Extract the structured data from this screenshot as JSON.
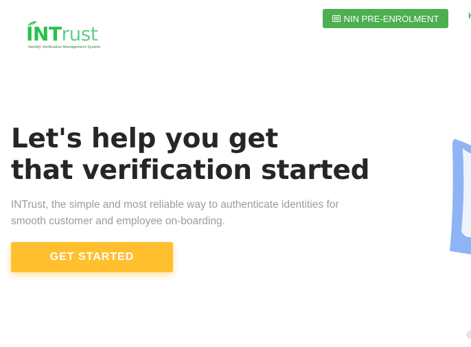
{
  "brand": {
    "logo_int": "INT",
    "logo_rust": "rust",
    "tagline": "Identity Verification Management System"
  },
  "header": {
    "nin_button_label": "NIN PRE-ENROLMENT",
    "nav_peek": "H"
  },
  "hero": {
    "title_line1": "Let's help you get",
    "title_line2": "that verification started",
    "subtitle": "INTrust, the simple and most reliable way to authenticate identities for smooth customer and employee on-boarding.",
    "cta_label": "GET STARTED"
  },
  "colors": {
    "brand_green": "#27c24c",
    "button_green": "#4caf50",
    "cta_yellow": "#ffbf2f",
    "title_text": "#262626",
    "subtitle_text": "#9a9aa4",
    "illustration_blue": "#8fb4f5"
  },
  "icons": {
    "nin_button_icon": "id-card-icon",
    "logo_mark": "leaf-icon"
  }
}
